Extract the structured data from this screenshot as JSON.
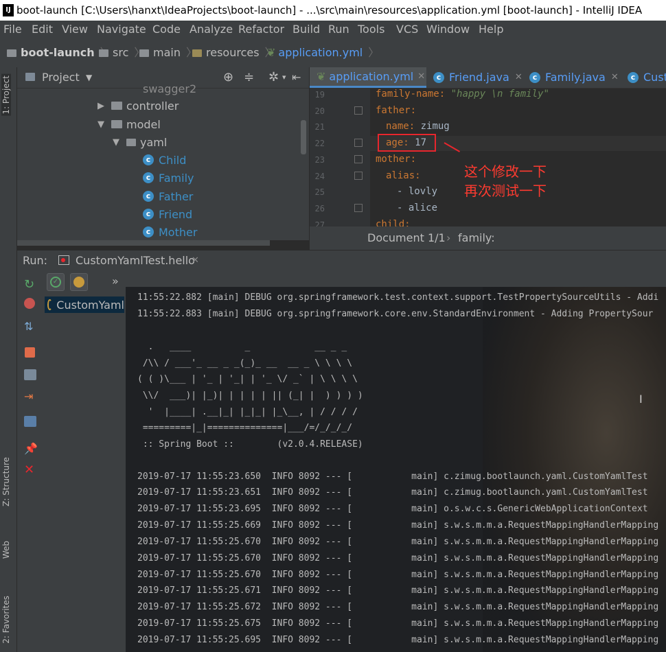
{
  "title": "boot-launch [C:\\Users\\hanxt\\IdeaProjects\\boot-launch] - ...\\src\\main\\resources\\application.yml [boot-launch] - IntelliJ IDEA",
  "app_icon": "IJ",
  "menu": [
    "File",
    "Edit",
    "View",
    "Navigate",
    "Code",
    "Analyze",
    "Refactor",
    "Build",
    "Run",
    "Tools",
    "VCS",
    "Window",
    "Help"
  ],
  "breadcrumb": [
    "boot-launch",
    "src",
    "main",
    "resources",
    "application.yml"
  ],
  "left_strip": {
    "project": "1: Project",
    "structure": "Z: Structure",
    "web": "Web",
    "favorites": "2: Favorites"
  },
  "project": {
    "header": "Project",
    "items": [
      {
        "label": "swagger2"
      },
      {
        "label": "controller"
      },
      {
        "label": "model"
      },
      {
        "label": "yaml"
      },
      {
        "label": "Child"
      },
      {
        "label": "Family"
      },
      {
        "label": "Father"
      },
      {
        "label": "Friend"
      },
      {
        "label": "Mother"
      }
    ]
  },
  "editor_tabs": [
    "application.yml",
    "Friend.java",
    "Family.java",
    "Cust"
  ],
  "code": {
    "lines": [
      "19",
      "20",
      "21",
      "22",
      "23",
      "24",
      "25",
      "26",
      "27"
    ],
    "family_name_key": "family-name:",
    "family_name_val": "\"happy \\n family\"",
    "father_key": "father:",
    "name_key": "name:",
    "name_val": "zimug",
    "age_key": "age:",
    "age_val": "17",
    "mother_key": "mother:",
    "alias_key": "alias:",
    "alias_1": "- lovly",
    "alias_2": "- alice",
    "child_key": "child:"
  },
  "doc_status": {
    "document": "Document 1/1",
    "path": "family:"
  },
  "annotation": {
    "line1": "这个修改一下",
    "line2": "再次测试一下"
  },
  "run": {
    "label": "Run:",
    "tab": "CustomYamlTest.hello",
    "tree_item": "CustomYaml"
  },
  "console": [
    "11:55:22.882 [main] DEBUG org.springframework.test.context.support.TestPropertySourceUtils - Addi",
    "11:55:22.883 [main] DEBUG org.springframework.core.env.StandardEnvironment - Adding PropertySour",
    "",
    "  .   ____          _            __ _ _",
    " /\\\\ / ___'_ __ _ _(_)_ __  __ _ \\ \\ \\ \\",
    "( ( )\\___ | '_ | '_| | '_ \\/ _` | \\ \\ \\ \\",
    " \\\\/  ___)| |_)| | | | | || (_| |  ) ) ) )",
    "  '  |____| .__|_| |_|_| |_\\__, | / / / /",
    " =========|_|==============|___/=/_/_/_/",
    " :: Spring Boot ::        (v2.0.4.RELEASE)",
    "",
    "2019-07-17 11:55:23.650  INFO 8092 --- [           main] c.zimug.bootlaunch.yaml.CustomYamlTest",
    "2019-07-17 11:55:23.651  INFO 8092 --- [           main] c.zimug.bootlaunch.yaml.CustomYamlTest",
    "2019-07-17 11:55:23.695  INFO 8092 --- [           main] o.s.w.c.s.GenericWebApplicationContext",
    "2019-07-17 11:55:25.669  INFO 8092 --- [           main] s.w.s.m.m.a.RequestMappingHandlerMapping",
    "2019-07-17 11:55:25.670  INFO 8092 --- [           main] s.w.s.m.m.a.RequestMappingHandlerMapping",
    "2019-07-17 11:55:25.670  INFO 8092 --- [           main] s.w.s.m.m.a.RequestMappingHandlerMapping",
    "2019-07-17 11:55:25.670  INFO 8092 --- [           main] s.w.s.m.m.a.RequestMappingHandlerMapping",
    "2019-07-17 11:55:25.671  INFO 8092 --- [           main] s.w.s.m.m.a.RequestMappingHandlerMapping",
    "2019-07-17 11:55:25.672  INFO 8092 --- [           main] s.w.s.m.m.a.RequestMappingHandlerMapping",
    "2019-07-17 11:55:25.675  INFO 8092 --- [           main] s.w.s.m.m.a.RequestMappingHandlerMapping",
    "2019-07-17 11:55:25.695  INFO 8092 --- [           main] s.w.s.m.m.a.RequestMappingHandlerMapping"
  ],
  "colors": {
    "accent": "#3d8fc6",
    "annotation": "#e8262d",
    "keyword": "#cc7832"
  }
}
